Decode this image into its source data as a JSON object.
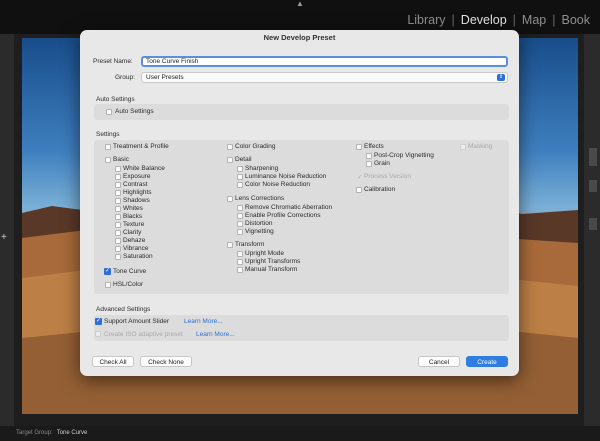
{
  "modules": [
    "Library",
    "Develop",
    "Map",
    "Book"
  ],
  "active_module": "Develop",
  "bottom": {
    "label": "Target Group:",
    "value": "Tone Curve"
  },
  "dialog": {
    "title": "New Develop Preset",
    "preset_name_label": "Preset Name:",
    "preset_name_value": "Tone Curve Finish",
    "group_label": "Group:",
    "group_value": "User Presets",
    "auto_section": "Auto Settings",
    "auto_item": "Auto Settings",
    "settings_section": "Settings",
    "col1": {
      "treatment": "Treatment & Profile",
      "basic": "Basic",
      "basic_items": [
        "White Balance",
        "Exposure",
        "Contrast",
        "Highlights",
        "Shadows",
        "Whites",
        "Blacks",
        "Texture",
        "Clarity",
        "Dehaze",
        "Vibrance",
        "Saturation"
      ],
      "tone_curve": "Tone Curve",
      "hsl": "HSL/Color"
    },
    "col2": {
      "color_grading": "Color Grading",
      "detail": "Detail",
      "detail_items": [
        "Sharpening",
        "Luminance Noise Reduction",
        "Color Noise Reduction"
      ],
      "lens": "Lens Corrections",
      "lens_items": [
        "Remove Chromatic Aberration",
        "Enable Profile Corrections",
        "Distortion",
        "Vignetting"
      ],
      "transform": "Transform",
      "transform_items": [
        "Upright Mode",
        "Upright Transforms",
        "Manual Transform"
      ]
    },
    "col3": {
      "effects": "Effects",
      "effects_items": [
        "Post-Crop Vignetting",
        "Grain"
      ],
      "process_version": "Process Version",
      "calibration": "Calibration",
      "masking": "Masking"
    },
    "advanced_section": "Advanced Settings",
    "support_amount": "Support Amount Slider",
    "create_iso": "Create ISO adaptive preset",
    "learn_more": "Learn More...",
    "check_all": "Check All",
    "check_none": "Check None",
    "cancel": "Cancel",
    "create": "Create"
  }
}
